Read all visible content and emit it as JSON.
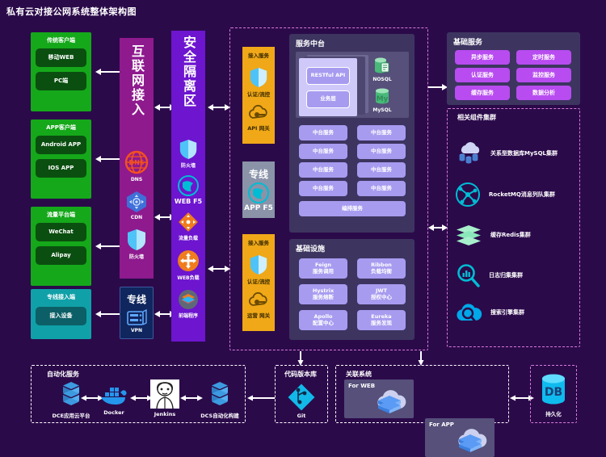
{
  "page_title": "私有云对接公网系统整体架构图",
  "clients": [
    {
      "title": "传统客户端",
      "color": "#15a81a",
      "items": [
        "移动WEB",
        "PC端"
      ]
    },
    {
      "title": "APP客户端",
      "color": "#15a81a",
      "items": [
        "Android APP",
        "IOS APP"
      ]
    },
    {
      "title": "流量平台端",
      "color": "#15a81a",
      "items": [
        "WeChat",
        "Alipay"
      ]
    },
    {
      "title": "专线接入端",
      "color": "#10a0a8",
      "items": [
        "接入设备"
      ]
    }
  ],
  "internet_column": {
    "title": "互联网接入",
    "icons": [
      {
        "name": "dns-icon",
        "label": "DNS"
      },
      {
        "name": "cdn-icon",
        "label": "CDN"
      },
      {
        "name": "firewall-icon",
        "label": "防火墙"
      }
    ]
  },
  "vpn_card": {
    "title": "专线",
    "icon": "vpn-icon",
    "label": "VPN"
  },
  "security_column": {
    "title": "安全隔离区",
    "icons": [
      {
        "name": "firewall-icon",
        "label": "防火墙"
      },
      {
        "name": "web-f5-icon",
        "label": "WEB F5"
      },
      {
        "name": "traffic-balance-icon",
        "label": "流量负载"
      },
      {
        "name": "web-balance-icon",
        "label": "WEB负载"
      },
      {
        "name": "frontend-app-icon",
        "label": "前端程序"
      }
    ]
  },
  "access_columns": [
    {
      "title": "接入服务",
      "icons": [
        {
          "name": "shield-icon",
          "label": "认证/流控"
        },
        {
          "name": "api-gateway-icon",
          "label": "API 网关"
        }
      ]
    },
    {
      "title": "接入服务",
      "icons": [
        {
          "name": "shield-icon",
          "label": "认证/流控"
        },
        {
          "name": "api-gateway-icon",
          "label": "运营 网关"
        }
      ]
    }
  ],
  "app_f5_card": {
    "title": "专线",
    "icon": "app-f5-icon",
    "label": "APP F5"
  },
  "service_center": {
    "title": "服务中台",
    "stack": [
      "RESTful API",
      "业务层"
    ],
    "databases": [
      {
        "name": "nosql-icon",
        "label": "NOSQL"
      },
      {
        "name": "mysql-icon",
        "label": "MySQL"
      }
    ],
    "services_left": [
      "中台服务",
      "中台服务",
      "中台服务",
      "中台服务"
    ],
    "services_right": [
      "中台服务",
      "中台服务",
      "中台服务",
      "中台服务"
    ],
    "footer_service": "编排服务"
  },
  "infrastructure": {
    "title": "基础设施",
    "items": [
      {
        "name": "Feign",
        "desc": "服务调用"
      },
      {
        "name": "Ribbon",
        "desc": "负载均衡"
      },
      {
        "name": "Hystrix",
        "desc": "服务熔断"
      },
      {
        "name": "JWT",
        "desc": "授权中心"
      },
      {
        "name": "Apollo",
        "desc": "配置中心"
      },
      {
        "name": "Eureka",
        "desc": "服务发现"
      }
    ]
  },
  "basic_services": {
    "title": "基础服务",
    "items": [
      "异步服务",
      "定时服务",
      "认证服务",
      "监控服务",
      "缓存服务",
      "数据分析"
    ]
  },
  "related_clusters": {
    "title": "相关组件集群",
    "items": [
      {
        "icon": "mysql-cluster-icon",
        "label": "关系型数据库MySQL集群"
      },
      {
        "icon": "rocketmq-icon",
        "label": "RocketMQ消息列队集群"
      },
      {
        "icon": "redis-icon",
        "label": "缓存Redis集群"
      },
      {
        "icon": "log-search-icon",
        "label": "日志归集集群"
      },
      {
        "icon": "search-engine-icon",
        "label": "搜索引擎集群"
      }
    ]
  },
  "automation": {
    "title": "自动化服务",
    "items": [
      {
        "icon": "cube-icon",
        "label": "DCE应用云平台"
      },
      {
        "icon": "docker-icon",
        "label": "Docker"
      },
      {
        "icon": "jenkins-icon",
        "label": "Jenkins"
      },
      {
        "icon": "cube-icon",
        "label": "DCS自动化构建"
      }
    ]
  },
  "code_repo": {
    "title": "代码版本库",
    "icon": "git-icon",
    "label": "Git"
  },
  "related_systems": {
    "title": "关联系统",
    "items": [
      {
        "label": "For WEB",
        "icon": "cloud-stack-icon"
      },
      {
        "label": "For APP",
        "icon": "cloud-stack-icon"
      }
    ]
  },
  "persistence": {
    "icon": "db-icon",
    "label": "持久化",
    "badge": "DB"
  }
}
